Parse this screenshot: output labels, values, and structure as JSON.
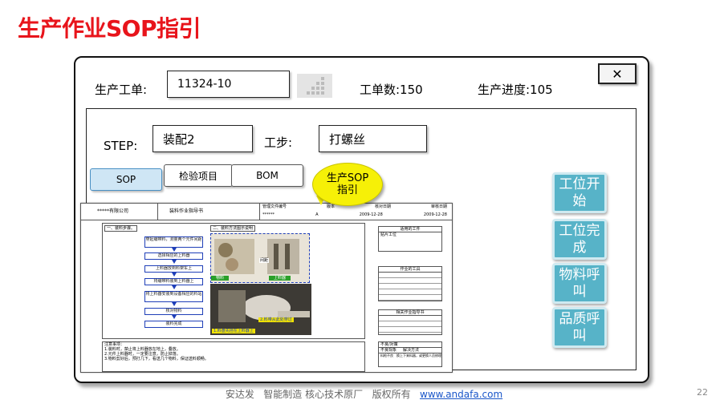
{
  "slide": {
    "title": "生产作业SOP指引",
    "page_number": "22"
  },
  "header": {
    "order_label": "生产工单:",
    "order_value": "11324-10",
    "count_label": "工单数:150",
    "progress_label": "生产进度:105",
    "close_label": "✕"
  },
  "step_row": {
    "step_label": "STEP:",
    "step_value": "装配2",
    "substep_label": "工步:",
    "substep_value": "打螺丝"
  },
  "tabs": [
    {
      "label": "SOP"
    },
    {
      "label": "检验项目"
    },
    {
      "label": "BOM"
    }
  ],
  "callout": "生产SOP指引",
  "side_buttons": [
    {
      "label": "工位开始"
    },
    {
      "label": "工位完成"
    },
    {
      "label": "物料呼叫"
    },
    {
      "label": "品质呼叫"
    }
  ],
  "sop_document": {
    "company": "*****有限公司",
    "doc_title": "装料作业指导书",
    "meta_headers": [
      "管理文件编号",
      "版本",
      "核对日期",
      "审核日期"
    ],
    "meta_values": [
      "******",
      "A",
      "2009-12-28",
      "2009-12-28"
    ],
    "section_steps": "一、装料步骤。",
    "section_method": "二、装料方法图示说明",
    "steps": [
      "穿起编带料，测量两个元件间距",
      "选择相应的上料器",
      "上料器放到料架车上",
      "将编带料装到上料器上",
      "将上料器安装到设备相应的料站",
      "核对物料",
      "装料完成"
    ],
    "photo_labels": [
      "物料",
      "上料器",
      "间距",
      "1.料盘先挂在上料器上",
      "2.料带从此处穿过"
    ],
    "side_titles": [
      "适用的工件",
      "作业的工具",
      "相关作业指导书"
    ],
    "side_values": [
      "贴片工位"
    ],
    "notes_title": "注意事项：",
    "notes": [
      "1.装料时，禁止将上料器放在地上，叠放。",
      "2.元件上料器时，一定要注意，防止掉落。",
      "3.物料剪好后，预打几下，看送几个物料，保证送料顺畅。"
    ],
    "bad_title": "不良/对策",
    "bad_headers": [
      "不良现象",
      "解决方法"
    ],
    "bad_rows": [
      [
        "料枪不良",
        "换上下来料器，或更换人员修理"
      ]
    ]
  },
  "footer": {
    "company": "安达发",
    "tagline": "智能制造 核心技术原厂",
    "rights": "版权所有",
    "url": "www.andafa.com"
  }
}
